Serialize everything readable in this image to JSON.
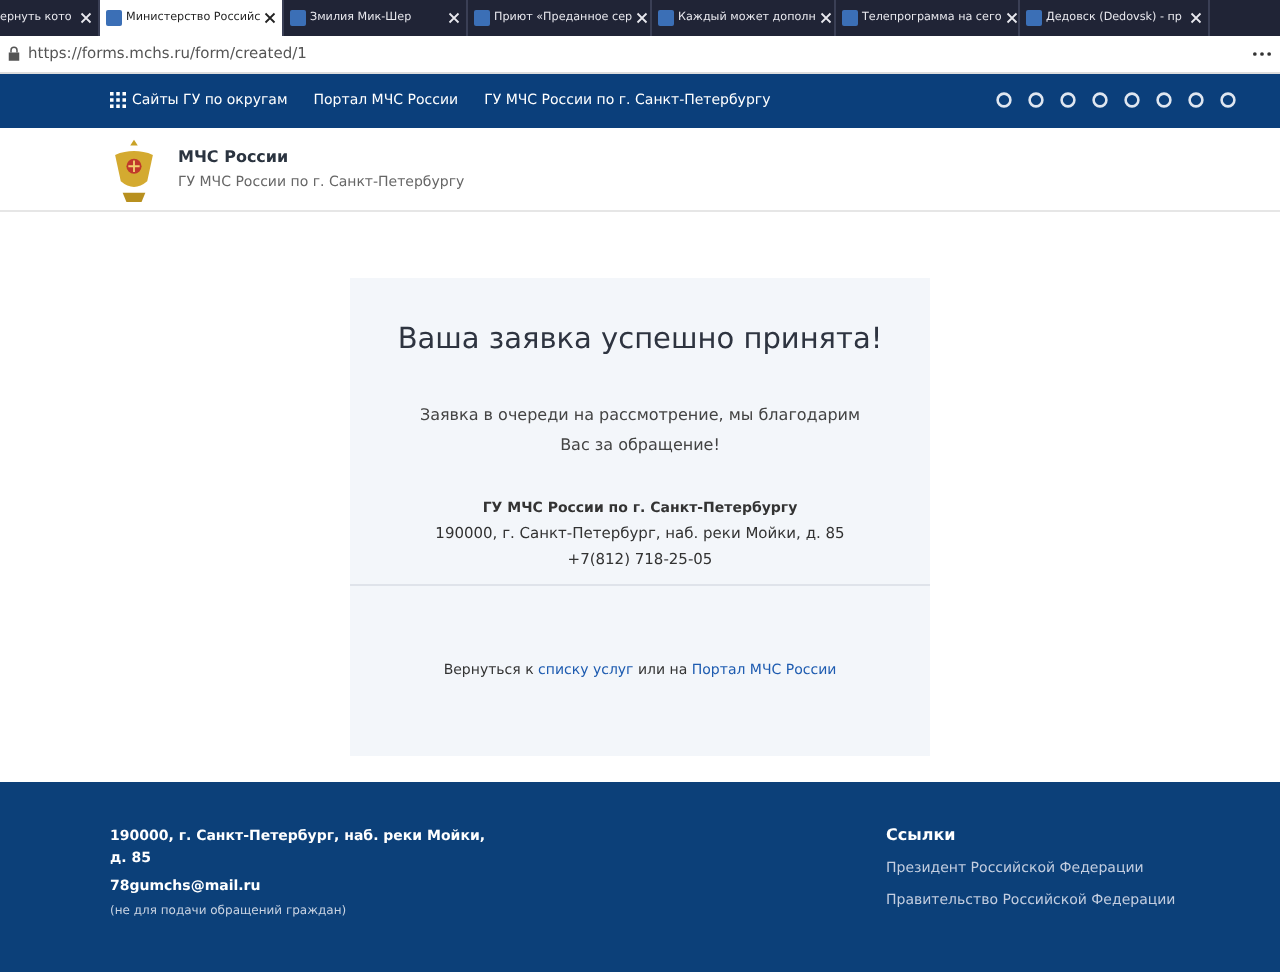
{
  "browser": {
    "tabs": [
      {
        "title": "ернуть кото",
        "selected": false
      },
      {
        "title": "Министерство Российс",
        "selected": true
      },
      {
        "title": "Змилия Мик-Шер",
        "selected": false
      },
      {
        "title": "Приют «Преданное сер",
        "selected": false
      },
      {
        "title": "Каждый может дополн",
        "selected": false
      },
      {
        "title": "Телепрограмма на сего",
        "selected": false
      },
      {
        "title": "Дедовск (Dedovsk) - пр",
        "selected": false
      }
    ],
    "url": "https://forms.mchs.ru/form/created/1"
  },
  "nav": {
    "items": [
      "Сайты ГУ по округам",
      "Портал МЧС России",
      "ГУ МЧС России по г. Санкт-Петербургу"
    ]
  },
  "header": {
    "title": "МЧС России",
    "subtitle": "ГУ МЧС России по г. Санкт-Петербургу"
  },
  "card": {
    "heading": "Ваша заявка успешно принята!",
    "message": "Заявка в очереди на рассмотрение, мы благодарим Вас за обращение!",
    "org": "ГУ МЧС России по г. Санкт-Петербургу",
    "address": "190000, г. Санкт-Петербург, наб. реки Мойки, д. 85",
    "phone": "+7(812) 718-25-05",
    "return": {
      "prefix": "Вернуться к",
      "link1": "списку услуг",
      "middle": "или на",
      "link2": "Портал МЧС России"
    }
  },
  "footer": {
    "address": "190000, г. Санкт-Петербург, наб. реки Мойки, д. 85",
    "email": "78gumchs@mail.ru",
    "note": "(не для подачи обращений граждан)",
    "links_title": "Ссылки",
    "links": [
      "Президент Российской Федерации",
      "Правительство Российской Федерации"
    ]
  }
}
